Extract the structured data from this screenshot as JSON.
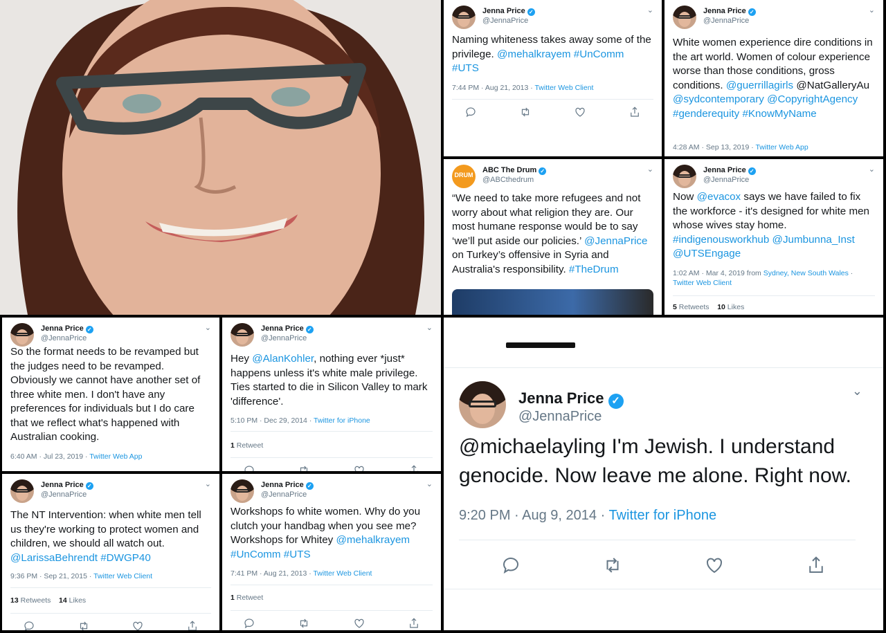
{
  "colors": {
    "link": "#1b95e0",
    "verified": "#1da1f2",
    "muted": "#657786"
  },
  "icons": {
    "reply": "reply-icon",
    "retweet": "retweet-icon",
    "like": "heart-icon",
    "share": "share-icon",
    "menu": "chevron-down-icon",
    "verified": "verified-badge-icon"
  },
  "tweets": {
    "t1": {
      "name": "Jenna Price",
      "handle": "@JennaPrice",
      "text": "Naming whiteness takes away some of the privilege.",
      "links": " @mehalkrayem #UnComm #UTS",
      "time": "7:44 PM · Aug 21, 2013 · ",
      "source": "Twitter Web Client"
    },
    "t2": {
      "name": "Jenna Price",
      "handle": "@JennaPrice",
      "text": "White women experience dire conditions in the art world. Women of colour experience worse than those conditions, gross conditions. ",
      "links1": "@guerrillagirls",
      "plain2": " @NatGalleryAu ",
      "links2": "@sydcontemporary @CopyrightAgency #genderequity  #KnowMyName",
      "time": "4:28 AM · Sep 13, 2019 · ",
      "source": "Twitter Web App"
    },
    "t3": {
      "name": "ABC The Drum",
      "handle": "@ABCthedrum",
      "logo": "DRUM",
      "text": "“We need to take more refugees and not worry about what religion they are. Our most humane response would be to say ‘we’ll put aside our policies.’ ",
      "link1": "@JennaPrice",
      "text2": " on Turkey’s offensive in Syria and Australia's responsibility. ",
      "link2": "#TheDrum"
    },
    "t4": {
      "name": "Jenna Price",
      "handle": "@JennaPrice",
      "pre": "Now ",
      "link1": "@evacox",
      "text": " says we have failed to fix the workforce - it's designed for white men whose wives stay home. ",
      "links": "#indigenousworkhub @Jumbunna_Inst @UTSEngage",
      "time": "1:02 AM · Mar 4, 2019 from ",
      "place": "Sydney, New South Wales",
      "sep": " · ",
      "source": "Twitter Web Client",
      "retweets": "5",
      "retweets_label": " Retweets",
      "likes": "10",
      "likes_label": " Likes"
    },
    "t5": {
      "name": "Jenna Price",
      "handle": "@JennaPrice",
      "text": "So the format needs to be revamped but the judges need to be revamped. Obviously we cannot have another set of three white men. I don't have any preferences for individuals but I do care that we reflect what's happened with Australian cooking.",
      "time": "6:40 AM · Jul 23, 2019 · ",
      "source": "Twitter Web App"
    },
    "t6": {
      "name": "Jenna Price",
      "handle": "@JennaPrice",
      "pre": "Hey ",
      "link1": "@AlanKohler",
      "text": ", nothing ever *just* happens unless it's white male privilege. Ties started to die in Silicon Valley to mark 'difference'.",
      "time": "5:10 PM · Dec 29, 2014 · ",
      "source": "Twitter for iPhone",
      "retweets": "1",
      "retweets_label": " Retweet"
    },
    "t7": {
      "name": "Jenna Price",
      "handle": "@JennaPrice",
      "text": "@michaelayling I'm Jewish. I understand genocide. Now leave me alone. Right now.",
      "time": "9:20 PM · Aug 9, 2014 · ",
      "source": "Twitter for iPhone"
    },
    "t8": {
      "name": "Jenna Price",
      "handle": "@JennaPrice",
      "text": "The NT Intervention: when white men tell us they're working to protect women and children, we should all watch out. ",
      "links": "@LarissaBehrendt #DWGP40",
      "time": "9:36 PM · Sep 21, 2015 · ",
      "source": "Twitter Web Client",
      "retweets": "13",
      "retweets_label": " Retweets",
      "likes": "14",
      "likes_label": " Likes"
    },
    "t9": {
      "name": "Jenna Price",
      "handle": "@JennaPrice",
      "text": "Workshops fo white women. Why do you clutch your handbag when you see me? Workshops for Whitey ",
      "links": "@mehalkrayem #UnComm #UTS",
      "time": "7:41 PM · Aug 21, 2013 · ",
      "source": "Twitter Web Client",
      "retweets": "1",
      "retweets_label": " Retweet"
    }
  }
}
